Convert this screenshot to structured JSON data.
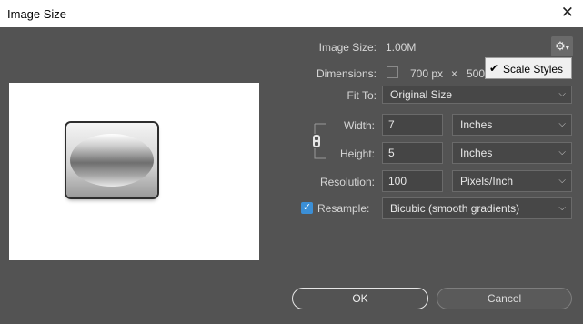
{
  "window": {
    "title": "Image Size",
    "close_glyph": "✕"
  },
  "image_size": {
    "label": "Image Size:",
    "value": "1.00M"
  },
  "dimensions": {
    "label": "Dimensions:",
    "width_text": "700 px",
    "times": "×",
    "height_text": "500"
  },
  "settings_menu": {
    "gear_icon": "gear-icon",
    "item_label": "Scale Styles",
    "item_checked": true
  },
  "fit_to": {
    "label": "Fit To:",
    "value": "Original Size"
  },
  "width": {
    "label": "Width:",
    "value": "7",
    "unit": "Inches"
  },
  "height": {
    "label": "Height:",
    "value": "5",
    "unit": "Inches"
  },
  "resolution": {
    "label": "Resolution:",
    "value": "100",
    "unit": "Pixels/Inch"
  },
  "resample": {
    "label": "Resample:",
    "checked": true,
    "value": "Bicubic (smooth gradients)"
  },
  "buttons": {
    "ok": "OK",
    "cancel": "Cancel"
  },
  "colors": {
    "dialog_bg": "#535353",
    "accent": "#3b8fd6",
    "field_bg": "#454545"
  }
}
